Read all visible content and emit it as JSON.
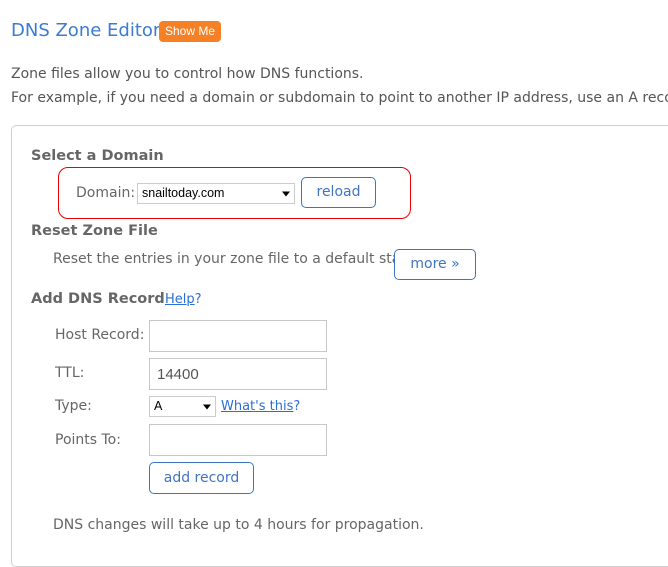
{
  "header": {
    "title": "DNS Zone Editor",
    "show_me_label": "Show Me"
  },
  "intro": {
    "line1": "Zone files allow you to control how DNS functions.",
    "line2": "For example, if you need a domain or subdomain to point to another IP address, use an A record."
  },
  "select_domain": {
    "heading": "Select a Domain",
    "domain_label": "Domain:",
    "domain_value": "snailtoday.com",
    "reload_label": "reload",
    "highlight_color": "#e00000"
  },
  "reset_zone": {
    "heading": "Reset Zone File",
    "description": "Reset the entries in your zone file to a default state.",
    "more_label": "more »"
  },
  "add_record": {
    "heading": "Add DNS Record",
    "help_link": "Help",
    "help_suffix": "?",
    "host_label": "Host Record:",
    "host_value": "",
    "ttl_label": "TTL:",
    "ttl_value": "14400",
    "type_label": "Type:",
    "type_value": "A",
    "whats_this_link": "What's this",
    "whats_this_suffix": "?",
    "points_label": "Points To:",
    "points_value": "",
    "add_label": "add record"
  },
  "footer_note": "DNS changes will take up to 4 hours for propagation."
}
